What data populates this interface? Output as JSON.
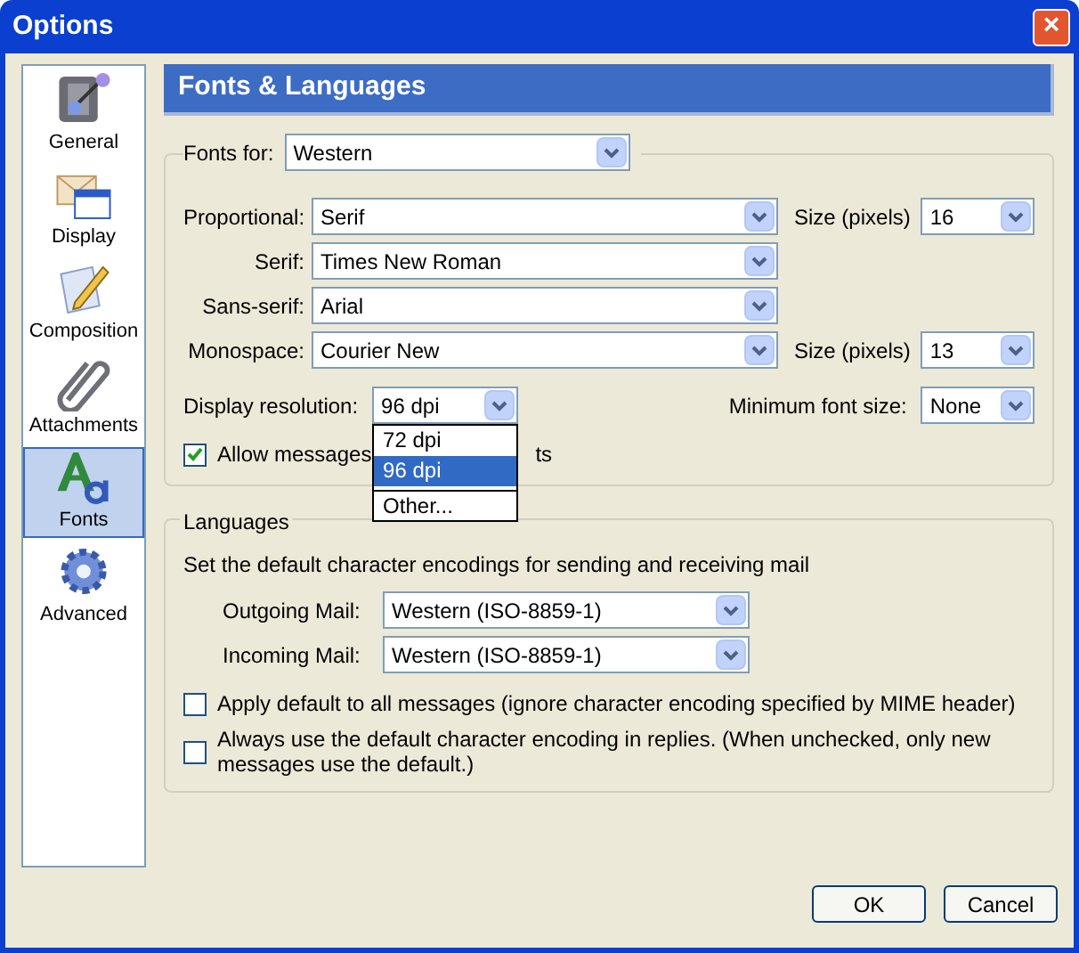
{
  "window": {
    "title": "Options",
    "close": "×"
  },
  "sidebar": {
    "items": [
      {
        "label": "General",
        "kind": "general",
        "selected": false
      },
      {
        "label": "Display",
        "kind": "display",
        "selected": false
      },
      {
        "label": "Composition",
        "kind": "composition",
        "selected": false
      },
      {
        "label": "Attachments",
        "kind": "attachments",
        "selected": false
      },
      {
        "label": "Fonts",
        "kind": "fonts",
        "selected": true
      },
      {
        "label": "Advanced",
        "kind": "advanced",
        "selected": false
      }
    ]
  },
  "header": "Fonts & Languages",
  "fonts": {
    "fonts_for": {
      "label": "Fonts for:",
      "value": "Western"
    },
    "rows": [
      {
        "label": "Proportional:",
        "value": "Serif",
        "size_label": "Size (pixels)",
        "size": "16"
      },
      {
        "label": "Serif:",
        "value": "Times New Roman"
      },
      {
        "label": "Sans-serif:",
        "value": "Arial"
      },
      {
        "label": "Monospace:",
        "value": "Courier New",
        "size_label": "Size (pixels)",
        "size": "13"
      }
    ],
    "resolution": {
      "label": "Display resolution:",
      "value": "96 dpi",
      "expanded": true,
      "options": [
        {
          "label": "72 dpi",
          "selected": false
        },
        {
          "label": "96 dpi",
          "selected": true
        },
        {
          "label": "Other...",
          "selected": false
        }
      ]
    },
    "minimum": {
      "label": "Minimum font size:",
      "value": "None"
    },
    "allow": {
      "label_start": "Allow messages",
      "label_end": "ts",
      "checked": true
    }
  },
  "languages": {
    "title": "Languages",
    "description": "Set the default character encodings for sending and receiving mail",
    "outgoing": {
      "label": "Outgoing Mail:",
      "value": "Western (ISO-8859-1)"
    },
    "incoming": {
      "label": "Incoming Mail:",
      "value": "Western (ISO-8859-1)"
    },
    "options": [
      {
        "label": "Apply default to all messages (ignore character encoding specified by MIME header)",
        "checked": false
      },
      {
        "label": "Always use the default character encoding in replies. (When unchecked, only new messages use the default.)",
        "checked": false
      }
    ]
  },
  "buttons": [
    "OK",
    "Cancel"
  ]
}
